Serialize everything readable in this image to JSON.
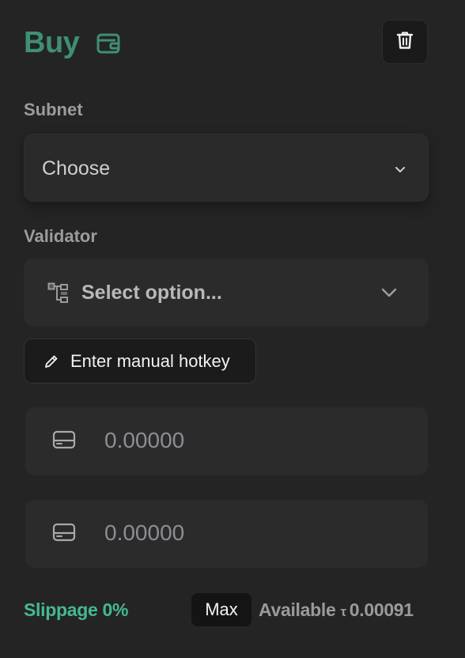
{
  "header": {
    "title": "Buy",
    "icons": {
      "wallet": "wallet-icon",
      "delete": "trash-icon"
    }
  },
  "subnet": {
    "label": "Subnet",
    "selected": "Choose",
    "icon": "chevron-down-icon"
  },
  "validator": {
    "label": "Validator",
    "placeholder": "Select option...",
    "icons": {
      "leading": "hierarchy-tree-icon",
      "trailing": "chevron-down-icon"
    }
  },
  "manual_hotkey": {
    "label": "Enter manual hotkey",
    "icon": "pencil-icon"
  },
  "amounts": [
    {
      "placeholder": "0.00000",
      "icon": "card-icon"
    },
    {
      "placeholder": "0.00000",
      "icon": "card-icon"
    }
  ],
  "footer": {
    "slippage": "Slippage 0%",
    "max_label": "Max",
    "available_label": "Available",
    "currency_symbol": "τ",
    "available_amount": "0.00091"
  },
  "colors": {
    "background": "#242424",
    "title_accent": "#3f8f74",
    "slippage_accent": "#45b894",
    "field_bg": "#2b2b2b"
  }
}
